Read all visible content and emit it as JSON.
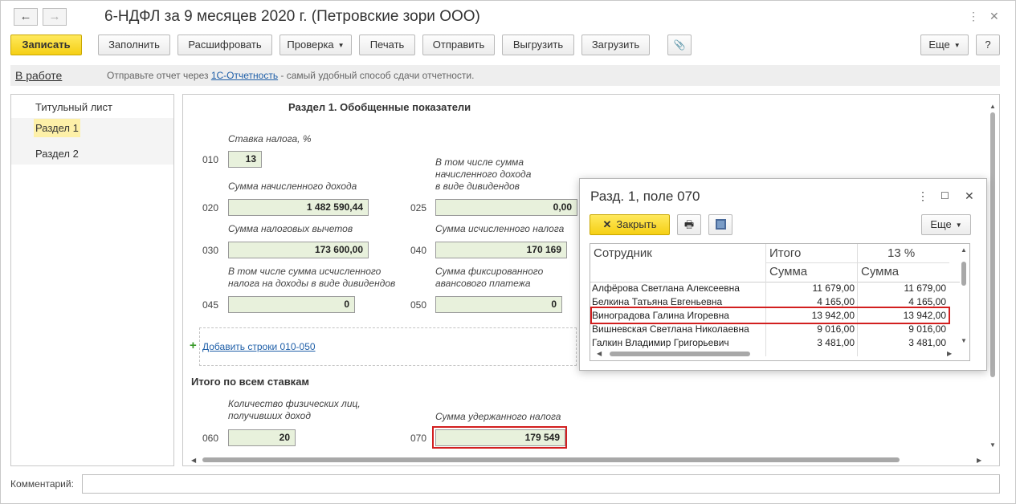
{
  "window": {
    "title": "6-НДФЛ за 9 месяцев 2020 г. (Петровские зори ООО)",
    "back_icon": "←",
    "forward_icon": "→",
    "more_icon": "⋮",
    "close_icon": "✕"
  },
  "toolbar": {
    "save": "Записать",
    "fill": "Заполнить",
    "decode": "Расшифровать",
    "check": "Проверка",
    "print": "Печать",
    "send": "Отправить",
    "export": "Выгрузить",
    "import": "Загрузить",
    "attach_icon": "📎",
    "more": "Еще",
    "help": "?"
  },
  "infobar": {
    "status": "В работе",
    "text_before": "Отправьте отчет через ",
    "link": "1С-Отчетность",
    "text_after": " - самый удобный способ сдачи отчетности."
  },
  "sidebar": {
    "items": [
      {
        "label": "Титульный лист"
      },
      {
        "label": "Раздел 1"
      },
      {
        "label": "Раздел 2"
      }
    ]
  },
  "form": {
    "section_title": "Раздел 1. Обобщенные показатели",
    "rate_label": "Ставка налога, %",
    "line010": {
      "code": "010",
      "value": "13"
    },
    "line020": {
      "code": "020",
      "label": "Сумма начисленного дохода",
      "value": "1 482 590,44"
    },
    "line025": {
      "code": "025",
      "label_lines": [
        "В том числе сумма",
        "начисленного дохода",
        "в виде дивидендов"
      ],
      "value": "0,00"
    },
    "line030": {
      "code": "030",
      "label": "Сумма налоговых вычетов",
      "value": "173 600,00"
    },
    "line040": {
      "code": "040",
      "label": "Сумма исчисленного налога",
      "value": "170 169"
    },
    "line045": {
      "code": "045",
      "label_lines": [
        "В том числе сумма исчисленного",
        "налога на доходы в виде дивидендов"
      ],
      "value": "0"
    },
    "line050": {
      "code": "050",
      "label_lines": [
        "Сумма фиксированного",
        "авансового платежа"
      ],
      "value": "0"
    },
    "add_rows": "Добавить строки 010-050",
    "totals_title": "Итого по всем ставкам",
    "line060": {
      "code": "060",
      "label_lines": [
        "Количество физических лиц,",
        "получивших доход"
      ],
      "value": "20"
    },
    "line070": {
      "code": "070",
      "label": "Сумма удержанного налога",
      "value": "179 549"
    }
  },
  "comment": {
    "label": "Комментарий:",
    "value": ""
  },
  "popup": {
    "title": "Разд. 1, поле 070",
    "close_button": "Закрыть",
    "close_x": "✕",
    "more": "Еще",
    "headers": {
      "employee": "Сотрудник",
      "total": "Итого",
      "rate": "13 %",
      "sum": "Сумма"
    },
    "rows": [
      {
        "name": "Алфёрова Светлана Алексеевна",
        "total": "11 679,00",
        "rate13": "11 679,00"
      },
      {
        "name": "Белкина Татьяна Евгеньевна",
        "total": "4 165,00",
        "rate13": "4 165,00"
      },
      {
        "name": "Виноградова Галина Игоревна",
        "total": "13 942,00",
        "rate13": "13 942,00"
      },
      {
        "name": "Вишневская Светлана Николаевна",
        "total": "9 016,00",
        "rate13": "9 016,00"
      },
      {
        "name": "Галкин Владимир Григорьевич",
        "total": "3 481,00",
        "rate13": "3 481,00"
      }
    ]
  }
}
